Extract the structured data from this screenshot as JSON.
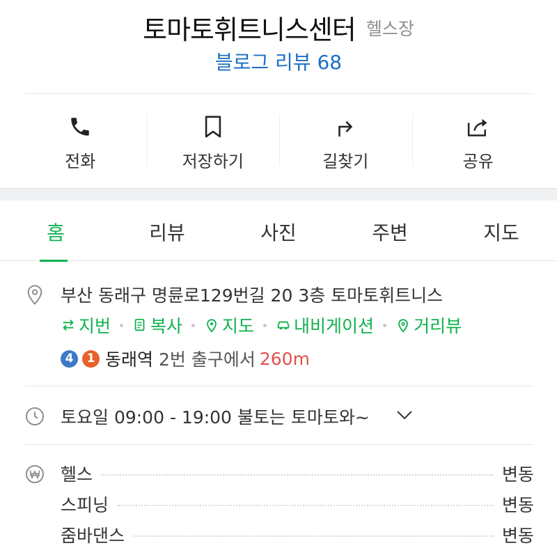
{
  "place": {
    "name": "토마토휘트니스센터",
    "category": "헬스장",
    "review_link": "블로그 리뷰 68"
  },
  "actions": [
    {
      "label": "전화",
      "icon": "phone-icon"
    },
    {
      "label": "저장하기",
      "icon": "bookmark-icon"
    },
    {
      "label": "길찾기",
      "icon": "directions-icon"
    },
    {
      "label": "공유",
      "icon": "share-icon"
    }
  ],
  "tabs": [
    {
      "label": "홈",
      "active": true
    },
    {
      "label": "리뷰",
      "active": false
    },
    {
      "label": "사진",
      "active": false
    },
    {
      "label": "주변",
      "active": false
    },
    {
      "label": "지도",
      "active": false
    }
  ],
  "address": {
    "text": "부산 동래구 명륜로129번길 20 3층 토마토휘트니스",
    "links": [
      "지번",
      "복사",
      "지도",
      "내비게이션",
      "거리뷰"
    ],
    "subway": {
      "lines": [
        "4",
        "1"
      ],
      "station": "동래역",
      "exit_text": "2번 출구에서",
      "distance": "260m"
    }
  },
  "hours": {
    "text": "토요일 09:00 - 19:00 불토는 토마토와~"
  },
  "prices": [
    {
      "name": "헬스",
      "value": "변동"
    },
    {
      "name": "스피닝",
      "value": "변동"
    },
    {
      "name": "줌바댄스",
      "value": "변동"
    }
  ],
  "colors": {
    "accent_green": "#0fb14e",
    "link_blue": "#1a6fc4",
    "distance_red": "#e0514a",
    "line4_blue": "#3f79c8",
    "line1_orange": "#e8602a"
  }
}
